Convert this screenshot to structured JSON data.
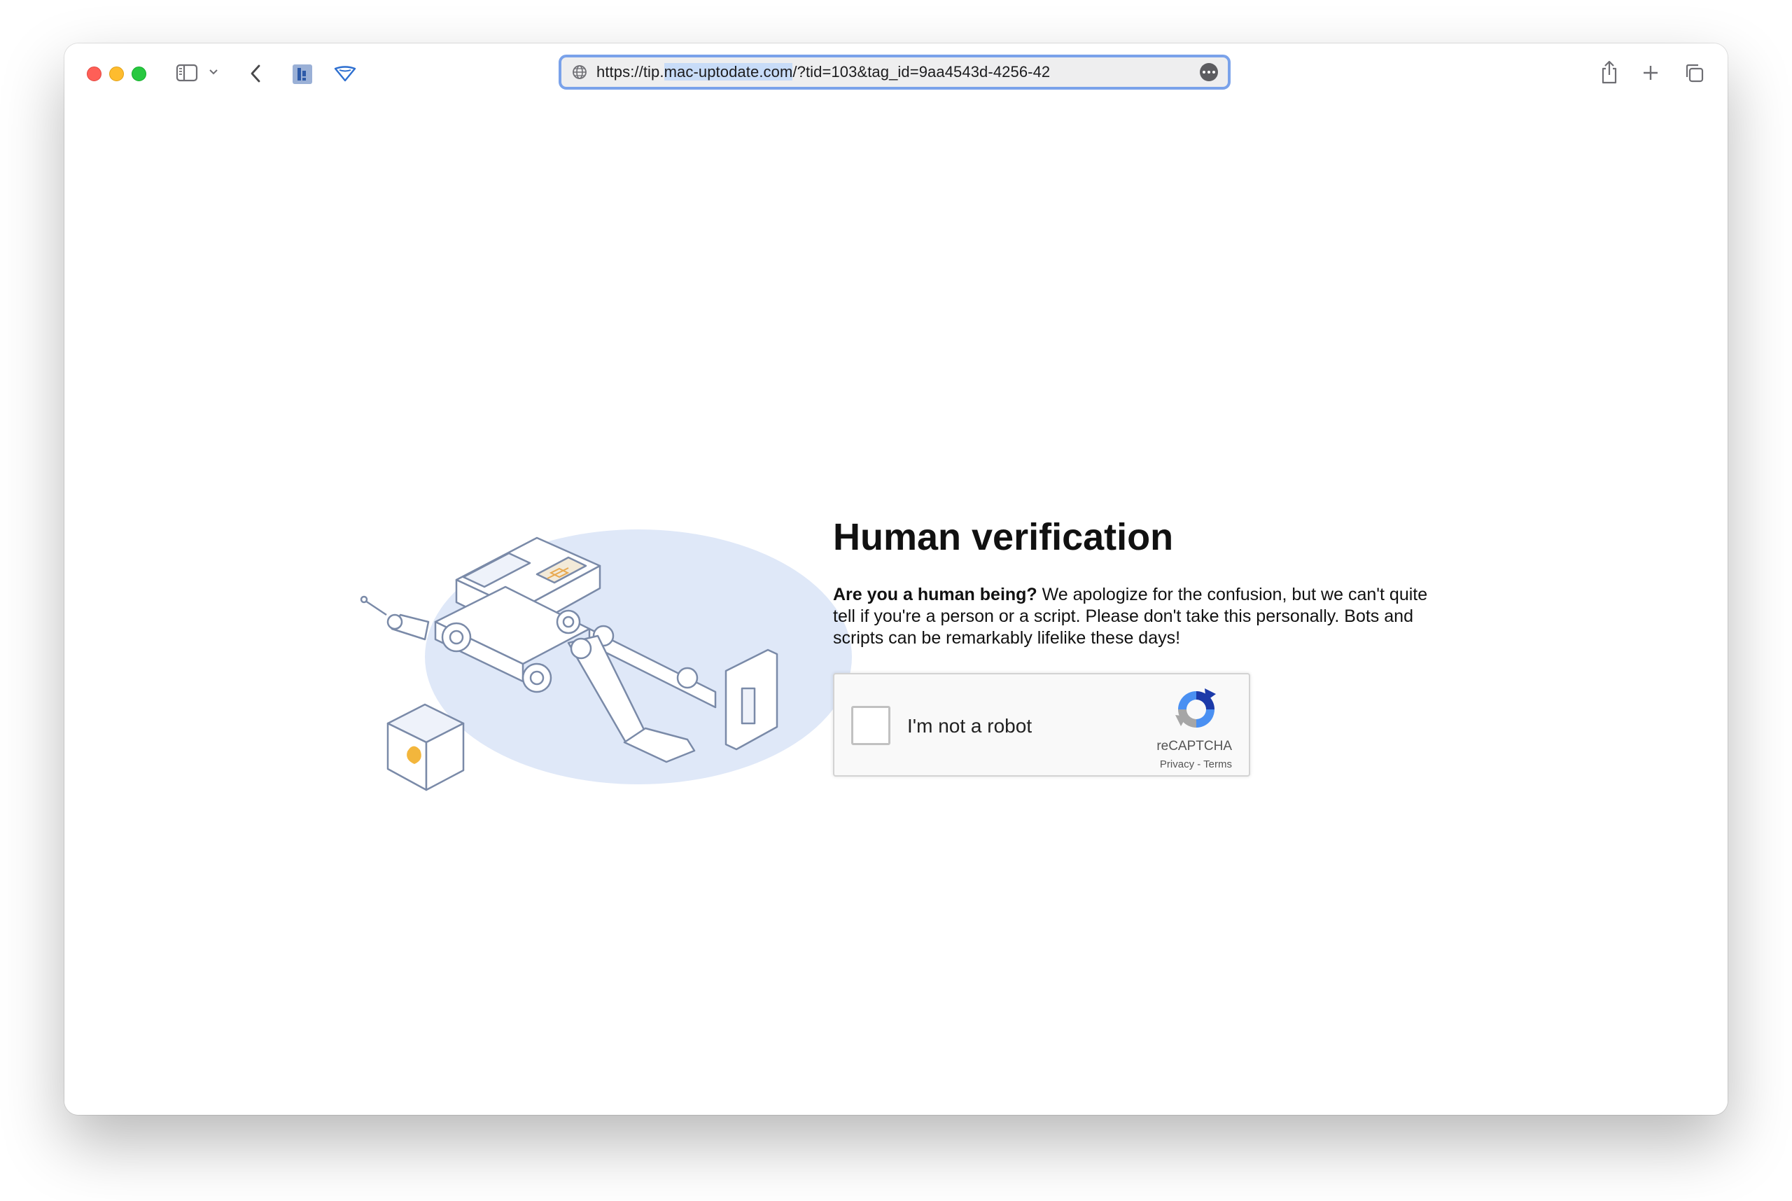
{
  "browser": {
    "url_prefix": "https://tip.",
    "url_selected": "mac-uptodate.com",
    "url_suffix": "/?tid=103&tag_id=9aa4543d-4256-42",
    "icons": {
      "sidebar": "sidebar-icon",
      "chevron": "chevron-down-icon",
      "back": "back-arrow-icon",
      "extension": "extension-icon",
      "shield": "privacy-icon",
      "globe": "globe-icon",
      "more": "more-icon",
      "share": "share-icon",
      "new_tab": "plus-icon",
      "tabs": "tab-overview-icon"
    },
    "colors": {
      "close": "#fe5f57",
      "minimize": "#febc2e",
      "maximize": "#28c840",
      "url_focus": "#7aa2ea"
    }
  },
  "page": {
    "title": "Human verification",
    "question": "Are you a human being?",
    "message": " We apologize for the confusion, but we can't quite tell if you're a person or a script. Please don't take this personally. Bots and scripts can be remarkably lifelike these days!"
  },
  "recaptcha": {
    "label": "I'm not a robot",
    "brand": "reCAPTCHA",
    "privacy": "Privacy",
    "separator": " - ",
    "terms": "Terms",
    "checked": false
  }
}
